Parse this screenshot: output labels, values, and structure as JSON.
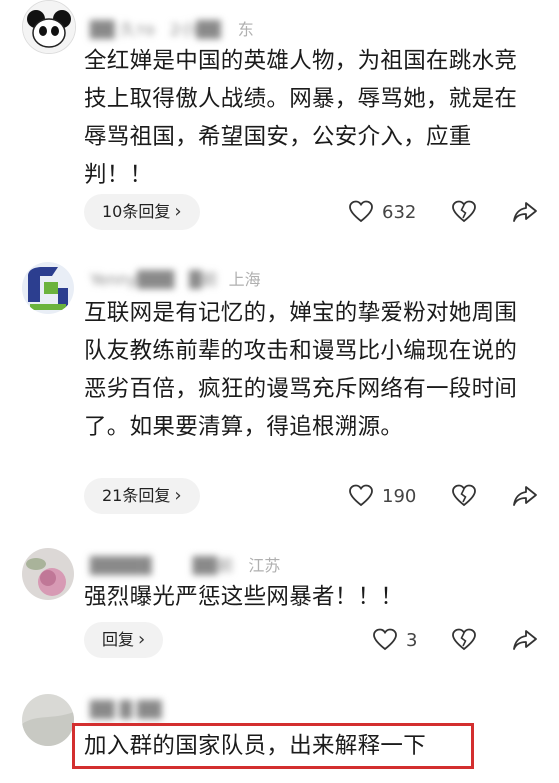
{
  "comments": [
    {
      "meta_name": "██ 久ᴛᴏ",
      "meta_time": "2小██",
      "meta_loc": "东",
      "text": "全红婵是中国的英雄人物，为祖国在跳水竞技上取得傲人战绩。网暴，辱骂她，就是在辱骂祖国，希望国安，公安介入，应重判！！",
      "reply_label": "10条回复",
      "likes": "632"
    },
    {
      "meta_name": "Yenny███",
      "meta_time": "█前",
      "meta_loc": "上海",
      "text": "互联网是有记忆的，婵宝的挚爱粉对她周围队友教练前辈的攻击和谩骂比小编现在说的恶劣百倍，疯狂的谩骂充斥网络有一段时间了。如果要清算，得追根溯源。",
      "reply_label": "21条回复",
      "likes": "190"
    },
    {
      "meta_name": "█████",
      "meta_time": "██前",
      "meta_loc": "江苏",
      "text": "强烈曝光严惩这些网暴者！！！",
      "reply_label": "回复",
      "likes": "3"
    },
    {
      "meta_name": "██ █ ██",
      "meta_time": "",
      "meta_loc": "",
      "text": "加入群的国家队员，出来解释一下"
    }
  ],
  "icons": {
    "like": "heart-outline-icon",
    "dislike": "broken-heart-icon",
    "share": "share-arrow-icon",
    "chevron": "chevron-right-icon"
  },
  "colors": {
    "highlight_border": "#d32f2f",
    "reply_bg": "#f2f2f2",
    "meta_gray": "#b0b0b0"
  }
}
